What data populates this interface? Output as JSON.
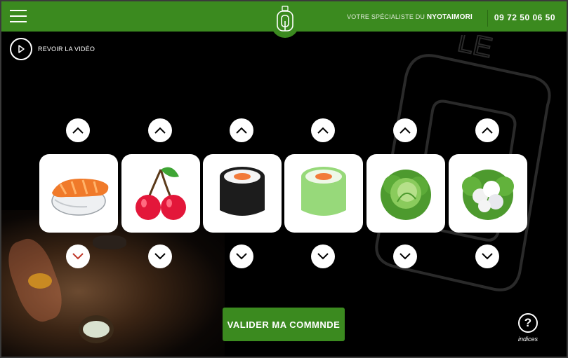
{
  "header": {
    "menu_icon": "hamburger-icon",
    "logo_icon": "nyotaimori-logo-icon",
    "tagline_prefix": "VOTRE SPÉCIALISTE DU",
    "tagline_brand": "NYOTAIMORI",
    "phone": "09 72 50 06 50",
    "brand_color": "#3b8a1f"
  },
  "video": {
    "icon": "play-icon",
    "label": "REVOIR LA VIDÉO"
  },
  "items": [
    {
      "name": "salmon-nigiri",
      "icon": "salmon-nigiri-icon",
      "down_active": true
    },
    {
      "name": "cherries",
      "icon": "cherry-icon",
      "down_active": false
    },
    {
      "name": "black-maki",
      "icon": "black-maki-icon",
      "down_active": false
    },
    {
      "name": "green-maki",
      "icon": "green-maki-icon",
      "down_active": false
    },
    {
      "name": "green-cabbage",
      "icon": "cabbage-icon",
      "down_active": false
    },
    {
      "name": "cauliflower",
      "icon": "cauliflower-icon",
      "down_active": false
    }
  ],
  "cta": {
    "label": "VALIDER MA COMMNDE"
  },
  "help": {
    "icon": "question-icon",
    "symbol": "?",
    "label": "indices"
  }
}
